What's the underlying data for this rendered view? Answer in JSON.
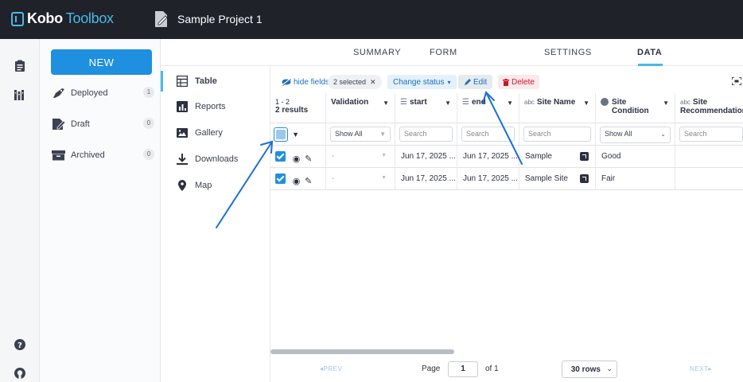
{
  "app": {
    "brand_kobo": "Kobo",
    "brand_toolbox": "Toolbox",
    "project_title": "Sample Project 1"
  },
  "sidebar": {
    "new_label": "NEW",
    "items": [
      {
        "label": "Deployed",
        "count": "1",
        "icon": "rocket-icon"
      },
      {
        "label": "Draft",
        "count": "0",
        "icon": "draft-icon"
      },
      {
        "label": "Archived",
        "count": "0",
        "icon": "archive-icon"
      }
    ]
  },
  "tabs": [
    {
      "label": "SUMMARY",
      "active": false
    },
    {
      "label": "FORM",
      "active": false
    },
    {
      "label": "DATA",
      "active": true
    },
    {
      "label": "SETTINGS",
      "active": false
    }
  ],
  "subnav": [
    {
      "label": "Table",
      "active": true,
      "icon": "table-icon"
    },
    {
      "label": "Reports",
      "active": false,
      "icon": "reports-icon"
    },
    {
      "label": "Gallery",
      "active": false,
      "icon": "gallery-icon"
    },
    {
      "label": "Downloads",
      "active": false,
      "icon": "download-icon"
    },
    {
      "label": "Map",
      "active": false,
      "icon": "map-pin-icon"
    }
  ],
  "toolbar": {
    "hide_fields": "hide fields",
    "selected": "2 selected",
    "change_status": "Change status",
    "edit": "Edit",
    "delete": "Delete"
  },
  "table": {
    "range": "1 - 2",
    "results": "2 results",
    "columns": [
      {
        "label": "Validation",
        "filter": "Show All"
      },
      {
        "label": "start",
        "filter": "Search"
      },
      {
        "label": "end",
        "filter": "Search"
      },
      {
        "label": "Site Name",
        "filter": "Search",
        "prefix": "abc"
      },
      {
        "label": "Site Condition",
        "filter": "Show All"
      },
      {
        "label": "Site Recommendatior",
        "filter": "Search",
        "prefix": "abc"
      }
    ],
    "rows": [
      {
        "validation": "-",
        "start": "Jun 17, 2025 ...",
        "end": "Jun 17, 2025 ...",
        "site_name": "Sample",
        "site_condition": "Good",
        "recommendation": ""
      },
      {
        "validation": "-",
        "start": "Jun 17, 2025 ...",
        "end": "Jun 17, 2025 ...",
        "site_name": "Sample Site",
        "site_condition": "Fair",
        "recommendation": ""
      }
    ]
  },
  "pager": {
    "prev": "PREV",
    "page_label": "Page",
    "page": "1",
    "of": "of 1",
    "rows": "30 rows",
    "next": "NEXT"
  },
  "colors": {
    "topbar": "#1f2229",
    "accent": "#1f8fe0",
    "tab_underline": "#4bb8e6",
    "delete": "#c3172c",
    "annotation_arrow": "#1a6fd6"
  }
}
